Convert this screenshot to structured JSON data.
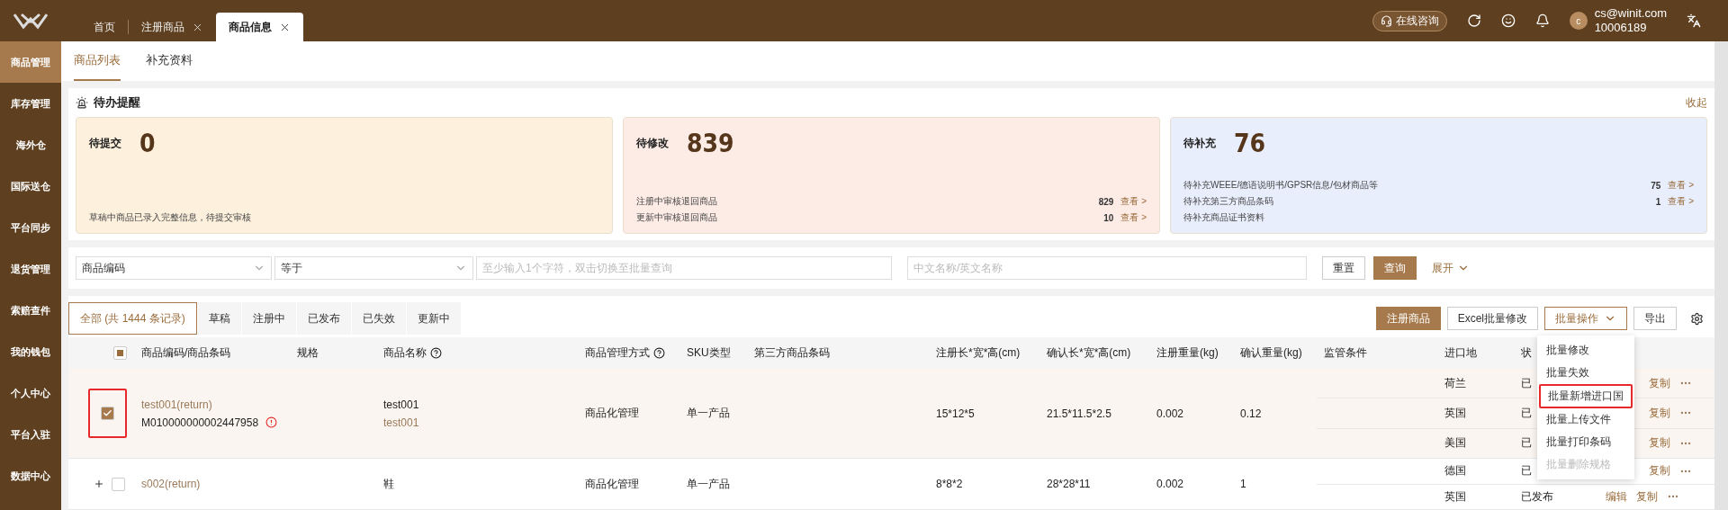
{
  "top_bar": {
    "tabs": [
      {
        "label": "首页",
        "closable": false,
        "selected": false
      },
      {
        "label": "注册商品",
        "closable": true,
        "selected": false
      },
      {
        "label": "商品信息",
        "closable": true,
        "selected": true
      }
    ],
    "consult_button": "在线咨询",
    "user": {
      "avatar": "c",
      "email": "cs@winit.com",
      "id": "10006189"
    }
  },
  "sidebar": {
    "items": [
      {
        "label": "商品管理",
        "selected": true
      },
      {
        "label": "库存管理",
        "selected": false
      },
      {
        "label": "海外仓",
        "selected": false
      },
      {
        "label": "国际送仓",
        "selected": false
      },
      {
        "label": "平台同步",
        "selected": false
      },
      {
        "label": "退货管理",
        "selected": false
      },
      {
        "label": "索赔查件",
        "selected": false
      },
      {
        "label": "我的钱包",
        "selected": false
      },
      {
        "label": "个人中心",
        "selected": false
      },
      {
        "label": "平台入驻",
        "selected": false
      },
      {
        "label": "数据中心",
        "selected": false
      }
    ]
  },
  "sub_tabs": [
    {
      "label": "商品列表",
      "selected": true
    },
    {
      "label": "补充资料",
      "selected": false
    }
  ],
  "reminders": {
    "title": "待办提醒",
    "collapse": "收起",
    "cards": [
      {
        "title": "待提交",
        "count": "0",
        "color": "#fdf1de",
        "items": [
          {
            "text": "草稿中商品已录入完整信息，待提交审核"
          }
        ]
      },
      {
        "title": "待修改",
        "count": "839",
        "color": "#fdece6",
        "items": [
          {
            "text": "注册中审核退回商品",
            "count": "829",
            "link": "查看 >"
          },
          {
            "text": "更新中审核退回商品",
            "count": "10",
            "link": "查看 >"
          }
        ]
      },
      {
        "title": "待补充",
        "count": "76",
        "color": "#e9eefc",
        "items": [
          {
            "text": "待补充WEEE/德语说明书/GPSR信息/包材商品等",
            "count": "75",
            "link": "查看 >"
          },
          {
            "text": "待补充第三方商品条码",
            "count": "1",
            "link": "查看 >"
          },
          {
            "text": "待补充商品证书资料"
          }
        ]
      }
    ]
  },
  "filters": {
    "field": "商品编码",
    "operator": "等于",
    "code_placeholder": "至少输入1个字符，双击切换至批量查询",
    "name_placeholder": "中文名称/英文名称",
    "reset": "重置",
    "search": "查询",
    "expand": "展开"
  },
  "status_tabs": [
    {
      "label": "全部 (共 1444 条记录)",
      "selected": true
    },
    {
      "label": "草稿",
      "selected": false
    },
    {
      "label": "注册中",
      "selected": false
    },
    {
      "label": "已发布",
      "selected": false
    },
    {
      "label": "已失效",
      "selected": false
    },
    {
      "label": "更新中",
      "selected": false
    }
  ],
  "actions": {
    "register": "注册商品",
    "excel": "Excel批量修改",
    "export": "导出",
    "batch": {
      "label": "批量操作",
      "open": true,
      "menu": [
        {
          "label": "批量修改",
          "disabled": false,
          "highlighted": false
        },
        {
          "label": "批量失效",
          "disabled": false,
          "highlighted": false
        },
        {
          "label": "批量新增进口国",
          "disabled": false,
          "highlighted": true
        },
        {
          "label": "批量上传文件",
          "disabled": false,
          "highlighted": false
        },
        {
          "label": "批量打印条码",
          "disabled": false,
          "highlighted": false
        },
        {
          "label": "批量删除规格",
          "disabled": true,
          "highlighted": false
        }
      ]
    }
  },
  "table": {
    "all_checked": false,
    "partly_checked": true,
    "columns": [
      {
        "label": "商品编码/商品条码",
        "kind": "plain"
      },
      {
        "label": "规格",
        "kind": "plain"
      },
      {
        "label": "商品名称",
        "kind": "help"
      },
      {
        "label": "商品管理方式",
        "kind": "help"
      },
      {
        "label": "SKU类型",
        "kind": "plain"
      },
      {
        "label": "第三方商品条码",
        "kind": "plain"
      },
      {
        "label": "注册长*宽*高(cm)",
        "kind": "plain"
      },
      {
        "label": "确认长*宽*高(cm)",
        "kind": "plain"
      },
      {
        "label": "注册重量(kg)",
        "kind": "plain"
      },
      {
        "label": "确认重量(kg)",
        "kind": "plain"
      },
      {
        "label": "监管条件",
        "kind": "plain"
      },
      {
        "label": "进口地",
        "kind": "plain"
      },
      {
        "label": "状",
        "kind": "plain"
      }
    ],
    "rows": [
      {
        "selected": true,
        "checked": true,
        "highlighted": true,
        "expandable": false,
        "code": "test001(return)",
        "barcode": "M010000000002447958",
        "warning": true,
        "name": "test001",
        "name_en": "test001",
        "management": "商品化管理",
        "sku_type": "单一产品",
        "reg_size": "15*12*5",
        "conf_size": "21.5*11.5*2.5",
        "reg_weight": "0.002",
        "conf_weight": "0.12",
        "destinations": [
          {
            "country": "荷兰",
            "status": "已",
            "actions": [
              "复制"
            ]
          },
          {
            "country": "英国",
            "status": "已",
            "actions": [
              "复制"
            ]
          },
          {
            "country": "美国",
            "status": "已",
            "actions": [
              "复制"
            ]
          }
        ]
      },
      {
        "selected": false,
        "checked": false,
        "highlighted": false,
        "expandable": true,
        "code": "s002(return)",
        "warning": false,
        "name": "鞋",
        "management": "商品化管理",
        "sku_type": "单一产品",
        "reg_size": "8*8*2",
        "conf_size": "28*28*11",
        "reg_weight": "0.002",
        "conf_weight": "1",
        "destinations": [
          {
            "country": "德国",
            "status": "已",
            "actions": [
              "复制"
            ]
          },
          {
            "country": "英国",
            "status": "已发布",
            "actions": [
              "编辑",
              "复制"
            ]
          }
        ]
      }
    ]
  }
}
